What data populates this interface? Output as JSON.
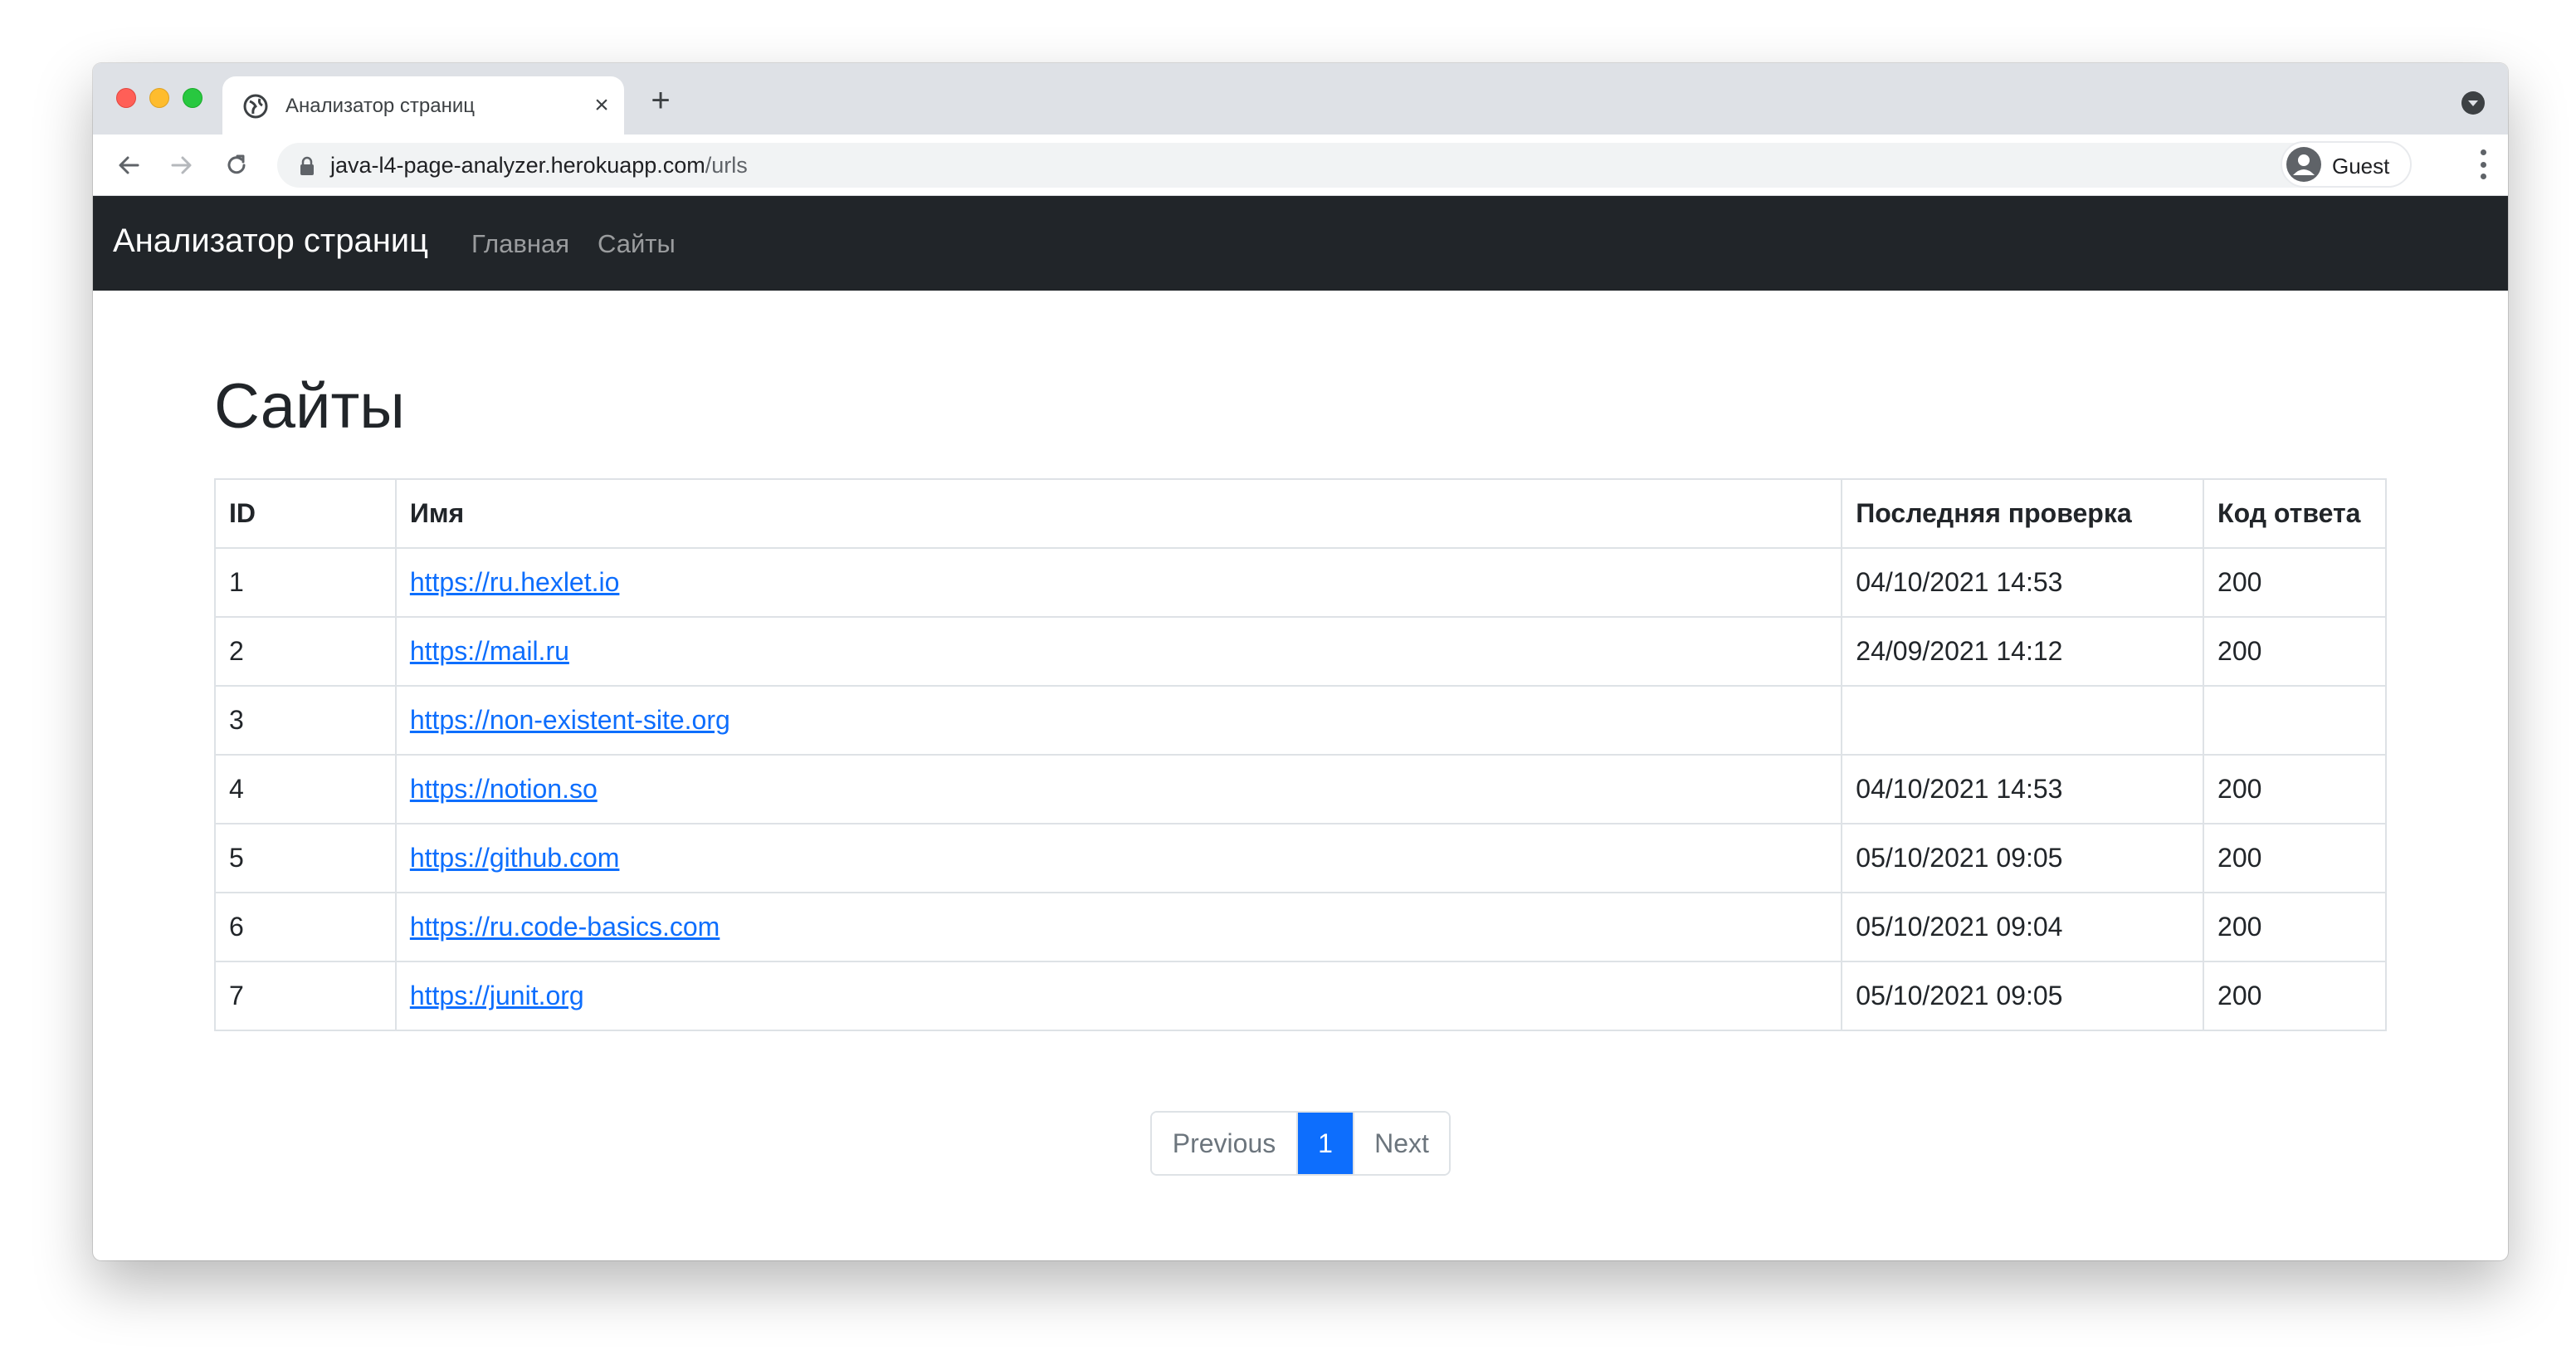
{
  "browser": {
    "tab_title": "Анализатор страниц",
    "new_tab_symbol": "+",
    "close_symbol": "×",
    "url_host": "java-l4-page-analyzer.herokuapp.com",
    "url_path": "/urls",
    "profile_label": "Guest"
  },
  "navbar": {
    "brand": "Анализатор страниц",
    "links": [
      "Главная",
      "Сайты"
    ]
  },
  "main": {
    "title": "Сайты",
    "table": {
      "headers": [
        "ID",
        "Имя",
        "Последняя проверка",
        "Код ответа"
      ],
      "rows": [
        {
          "id": "1",
          "name": "https://ru.hexlet.io",
          "checked": "04/10/2021 14:53",
          "code": "200"
        },
        {
          "id": "2",
          "name": "https://mail.ru",
          "checked": "24/09/2021 14:12",
          "code": "200"
        },
        {
          "id": "3",
          "name": "https://non-existent-site.org",
          "checked": "",
          "code": ""
        },
        {
          "id": "4",
          "name": "https://notion.so",
          "checked": "04/10/2021 14:53",
          "code": "200"
        },
        {
          "id": "5",
          "name": "https://github.com",
          "checked": "05/10/2021 09:05",
          "code": "200"
        },
        {
          "id": "6",
          "name": "https://ru.code-basics.com",
          "checked": "05/10/2021 09:04",
          "code": "200"
        },
        {
          "id": "7",
          "name": "https://junit.org",
          "checked": "05/10/2021 09:05",
          "code": "200"
        }
      ]
    },
    "pagination": {
      "previous": "Previous",
      "current": "1",
      "next": "Next"
    }
  },
  "colors": {
    "navbar_bg": "#212529",
    "link": "#0d6efd",
    "pagination_active": "#0d6efd"
  },
  "icons": [
    "globe-icon",
    "close-icon",
    "plus-icon",
    "back-arrow-icon",
    "forward-arrow-icon",
    "reload-icon",
    "lock-icon",
    "translate-icon",
    "avatar-icon",
    "kebab-menu-icon",
    "chevron-down-icon"
  ]
}
